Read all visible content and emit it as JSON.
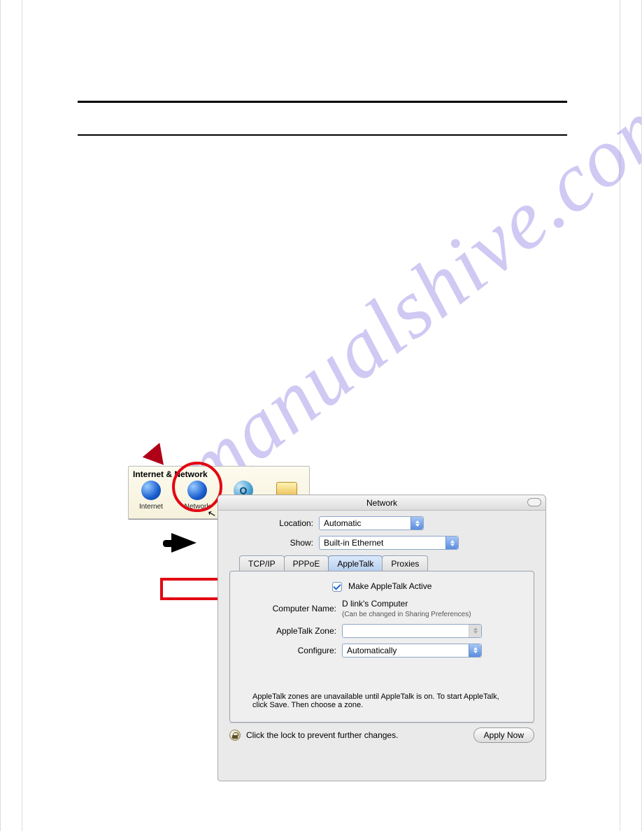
{
  "watermark": "manualshive.com",
  "netpanel": {
    "title": "Internet & Network",
    "icons": [
      "Internet",
      "Network",
      "QuickTime",
      "Sharing"
    ]
  },
  "window": {
    "title": "Network",
    "location_label": "Location:",
    "location_value": "Automatic",
    "show_label": "Show:",
    "show_value": "Built-in Ethernet",
    "tabs": [
      "TCP/IP",
      "PPPoE",
      "AppleTalk",
      "Proxies"
    ],
    "active_tab": 2,
    "appletalk": {
      "active_label": "Make AppleTalk Active",
      "active_checked": true,
      "computer_name_label": "Computer Name:",
      "computer_name_value": "D link's Computer",
      "computer_name_sub": "(Can be changed in Sharing Preferences)",
      "zone_label": "AppleTalk Zone:",
      "zone_value": "",
      "configure_label": "Configure:",
      "configure_value": "Automatically",
      "note": "AppleTalk zones are unavailable until AppleTalk is on. To start AppleTalk, click Save. Then choose a zone."
    },
    "lock_text": "Click the lock to prevent further changes.",
    "apply_label": "Apply Now"
  }
}
